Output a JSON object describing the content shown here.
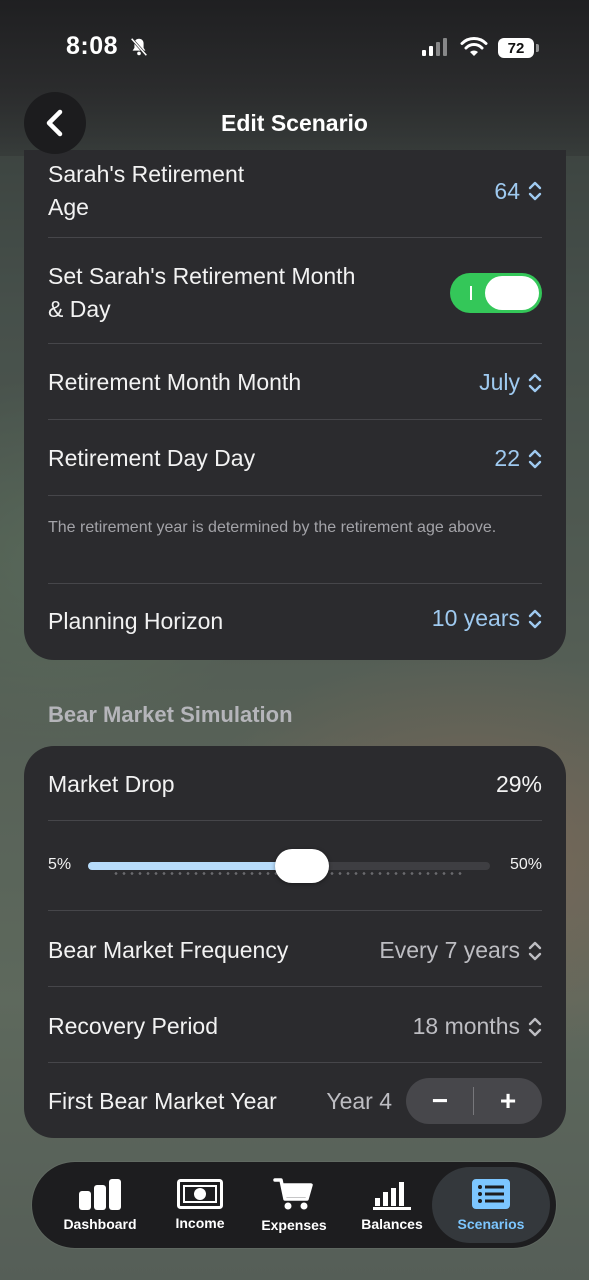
{
  "status_bar": {
    "time": "8:08",
    "battery": "72"
  },
  "header": {
    "title": "Edit Scenario"
  },
  "retirement": {
    "retirement_age_label": "Sarah's Retirement\nAge",
    "retirement_age_value": "64",
    "set_month_day_label": "Set Sarah's Retirement Month\n& Day",
    "set_month_day_on": true,
    "month_label": "Retirement Month  Month",
    "month_value": "July",
    "day_label": "Retirement Day  Day",
    "day_value": "22",
    "note": "The retirement year is determined by the retirement age above.",
    "horizon_label": "Planning Horizon",
    "horizon_value": "10 years"
  },
  "bear_market": {
    "section_title": "Bear Market Simulation",
    "market_drop_label": "Market Drop",
    "market_drop_value": "29%",
    "slider_min": "5%",
    "slider_max": "50%",
    "slider_fraction": 0.533,
    "frequency_label": "Bear Market Frequency",
    "frequency_value": "Every 7 years",
    "recovery_label": "Recovery Period",
    "recovery_value": "18 months",
    "first_year_label": "First Bear Market Year",
    "first_year_value": "Year 4",
    "minus": "−",
    "plus": "+"
  },
  "tabbar": {
    "tabs": [
      {
        "label": "Dashboard",
        "icon": "bar-chart-icon",
        "active": false
      },
      {
        "label": "Income",
        "icon": "banknote-icon",
        "active": false
      },
      {
        "label": "Expenses",
        "icon": "cart-icon",
        "active": false
      },
      {
        "label": "Balances",
        "icon": "balances-chart-icon",
        "active": false
      },
      {
        "label": "Scenarios",
        "icon": "list-icon",
        "active": true
      }
    ]
  },
  "colors": {
    "accent_blue": "#9fcaf0",
    "toggle_green": "#34c759",
    "active_tab": "#7cc6ff",
    "card_bg": "#2b2b2e"
  }
}
